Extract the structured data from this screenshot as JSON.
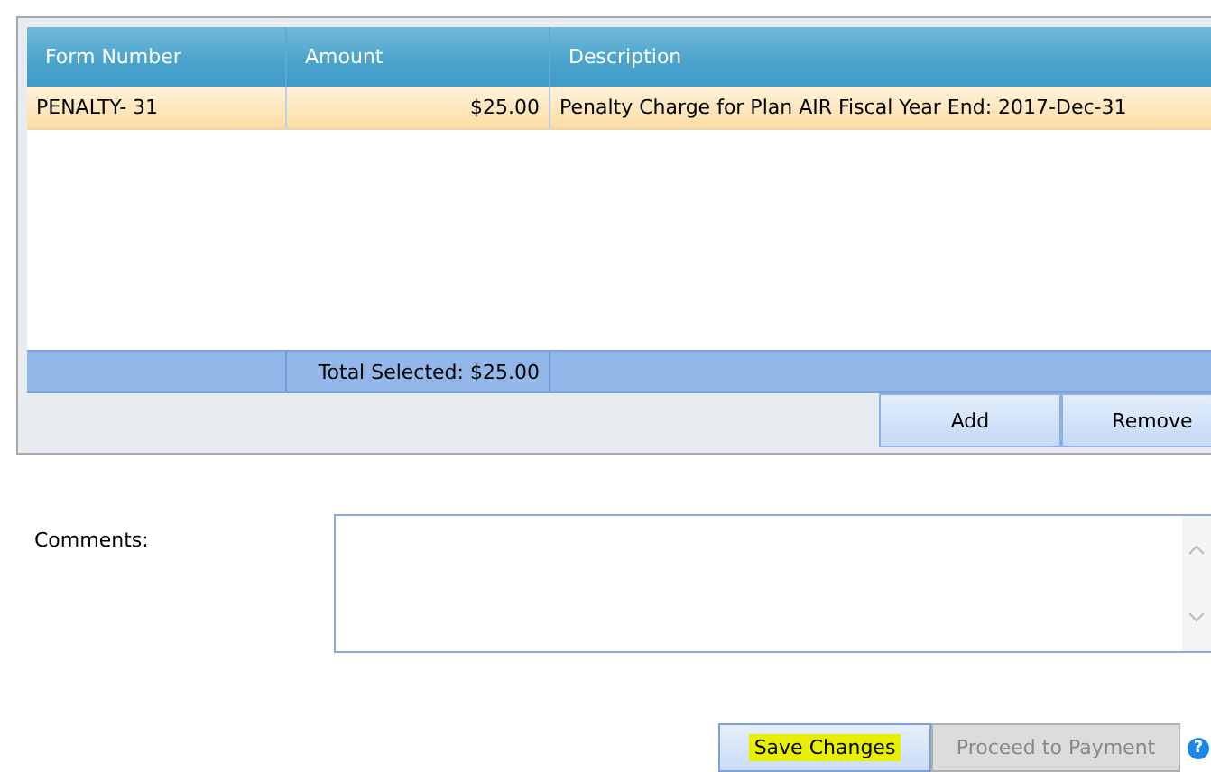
{
  "grid": {
    "columns": [
      "Form Number",
      "Amount",
      "Description"
    ],
    "rows": [
      {
        "cells": [
          "PENALTY- 31",
          "$25.00",
          "Penalty Charge for Plan AIR Fiscal Year End: 2017-Dec-31"
        ],
        "selected": true
      }
    ],
    "footer": {
      "total": "Total Selected: $25.00"
    },
    "buttons": [
      "Add",
      "Remove"
    ]
  },
  "comments": {
    "label": "Comments:"
  },
  "actions": [
    {
      "label": "Save Changes",
      "disabled": false,
      "highlighted": true
    },
    {
      "label": "Proceed to Payment",
      "disabled": true,
      "highlighted": false
    }
  ],
  "help": {
    "label": "?"
  }
}
